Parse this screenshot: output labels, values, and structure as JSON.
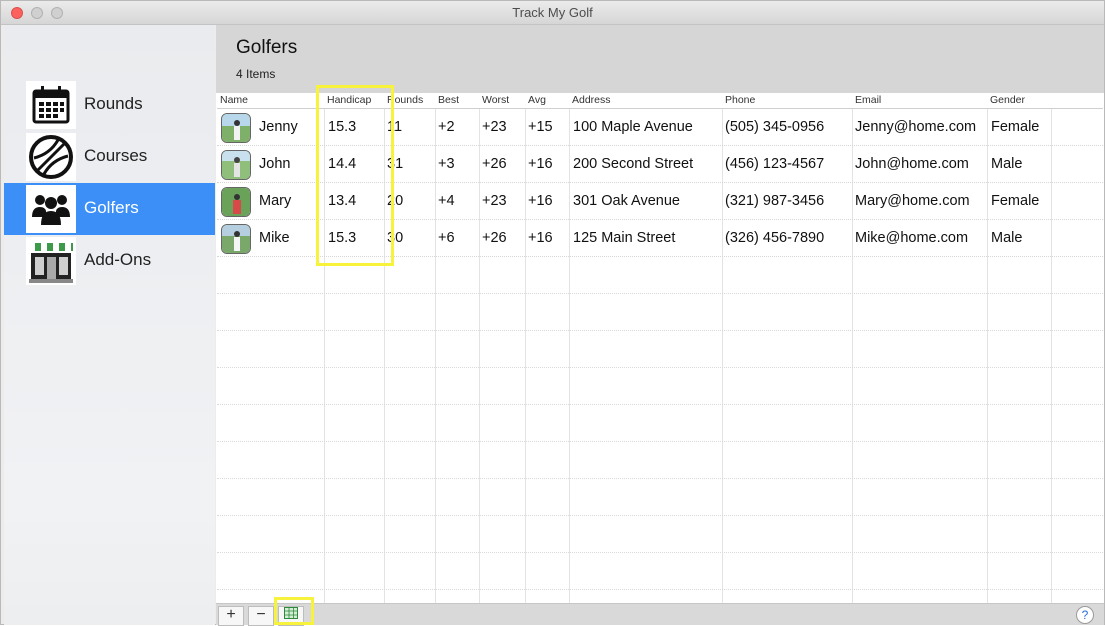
{
  "window": {
    "title": "Track My Golf"
  },
  "sidebar": {
    "items": [
      {
        "label": "Rounds",
        "icon": "calendar-icon",
        "selected": false
      },
      {
        "label": "Courses",
        "icon": "globe-icon",
        "selected": false
      },
      {
        "label": "Golfers",
        "icon": "people-icon",
        "selected": true
      },
      {
        "label": "Add-Ons",
        "icon": "storefront-icon",
        "selected": false
      }
    ]
  },
  "main": {
    "title": "Golfers",
    "count": "4 Items"
  },
  "table": {
    "columns": [
      "Name",
      "Handicap",
      "Rounds",
      "Best",
      "Worst",
      "Avg",
      "Address",
      "Phone",
      "Email",
      "Gender"
    ],
    "rows": [
      {
        "name": "Jenny",
        "handicap": "15.3",
        "rounds": "11",
        "best": "+2",
        "worst": "+23",
        "avg": "+15",
        "address": "100 Maple Avenue",
        "phone": "(505) 345-0956",
        "email": "Jenny@home.com",
        "gender": "Female"
      },
      {
        "name": "John",
        "handicap": "14.4",
        "rounds": "31",
        "best": "+3",
        "worst": "+26",
        "avg": "+16",
        "address": "200 Second Street",
        "phone": "(456) 123-4567",
        "email": "John@home.com",
        "gender": "Male"
      },
      {
        "name": "Mary",
        "handicap": "13.4",
        "rounds": "20",
        "best": "+4",
        "worst": "+23",
        "avg": "+16",
        "address": "301 Oak Avenue",
        "phone": "(321) 987-3456",
        "email": "Mary@home.com",
        "gender": "Female"
      },
      {
        "name": "Mike",
        "handicap": "15.3",
        "rounds": "30",
        "best": "+6",
        "worst": "+26",
        "avg": "+16",
        "address": "125 Main Street",
        "phone": "(326) 456-7890",
        "email": "Mike@home.com",
        "gender": "Male"
      }
    ]
  },
  "bottombar": {
    "add_label": "+",
    "remove_label": "−",
    "help_label": "?"
  },
  "colors": {
    "selection": "#3b8ff6",
    "highlight": "#f7f23b",
    "close": "#fc615d"
  }
}
